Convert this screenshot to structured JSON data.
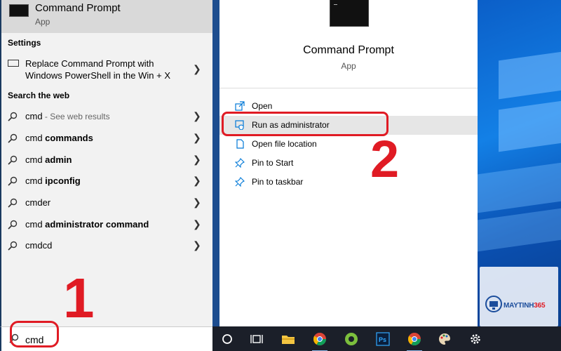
{
  "best_match": {
    "name": "Command Prompt",
    "type": "App"
  },
  "settings": {
    "header": "Settings",
    "item": {
      "label": "Replace Command Prompt with Windows PowerShell in the Win + X"
    }
  },
  "web": {
    "header": "Search the web",
    "items": [
      {
        "bold": "",
        "plain": "cmd",
        "hint": " - See web results"
      },
      {
        "plain": "cmd ",
        "bold": "commands",
        "hint": ""
      },
      {
        "plain": "cmd ",
        "bold": "admin",
        "hint": ""
      },
      {
        "plain": "cmd ",
        "bold": "ipconfig",
        "hint": ""
      },
      {
        "plain": "cmd",
        "bold": "er",
        "hint": ""
      },
      {
        "plain": "cmd ",
        "bold": "administrator command",
        "hint": ""
      },
      {
        "plain": "cmd",
        "bold": "cd",
        "hint": ""
      }
    ]
  },
  "search": {
    "value": "cmd"
  },
  "preview": {
    "title": "Command Prompt",
    "subtitle": "App",
    "actions": [
      {
        "label": "Open",
        "icon": "open-icon"
      },
      {
        "label": "Run as administrator",
        "icon": "shield-icon"
      },
      {
        "label": "Open file location",
        "icon": "file-icon"
      },
      {
        "label": "Pin to Start",
        "icon": "pin-icon"
      },
      {
        "label": "Pin to taskbar",
        "icon": "pin-icon"
      }
    ]
  },
  "annotations": {
    "step1": "1",
    "step2": "2"
  },
  "watermark": {
    "brand_a": "MAYTINH",
    "brand_b": "365"
  },
  "colors": {
    "accent": "#0078d7",
    "annotation": "#e01b24",
    "taskbar": "#1b1f29"
  }
}
